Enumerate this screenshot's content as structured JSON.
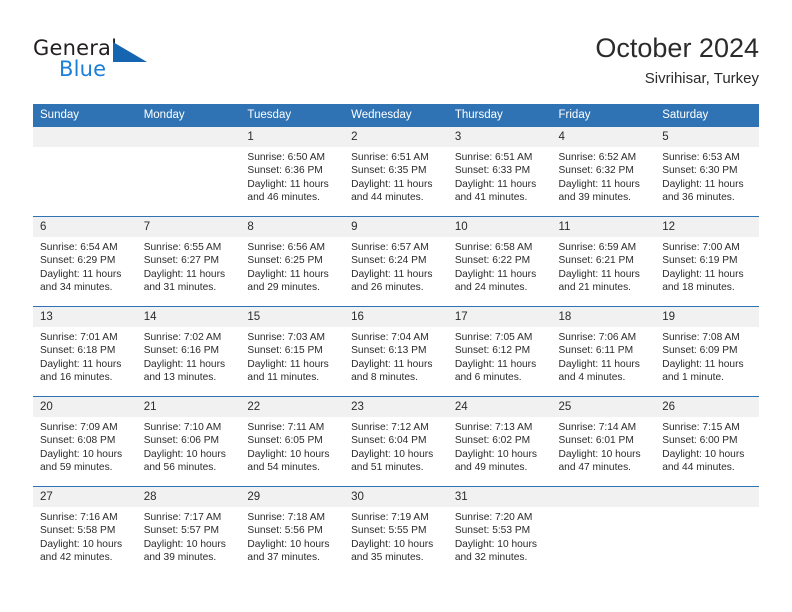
{
  "brand": {
    "word_one": "General",
    "word_two": "Blue",
    "logo_icon": "triangle-flag-icon",
    "accent_color": "#1565b0"
  },
  "header": {
    "title": "October 2024",
    "subtitle": "Sivrihisar, Turkey"
  },
  "theme": {
    "header_blue": "#3073b4",
    "daynum_bg": "#f1f1f1",
    "text": "#2b2b2b"
  },
  "weekday_headers": [
    "Sunday",
    "Monday",
    "Tuesday",
    "Wednesday",
    "Thursday",
    "Friday",
    "Saturday"
  ],
  "weeks": [
    [
      {
        "day": "",
        "empty": true
      },
      {
        "day": "",
        "empty": true
      },
      {
        "day": "1",
        "sunrise": "Sunrise: 6:50 AM",
        "sunset": "Sunset: 6:36 PM",
        "daylight_line1": "Daylight: 11 hours",
        "daylight_line2": "and 46 minutes."
      },
      {
        "day": "2",
        "sunrise": "Sunrise: 6:51 AM",
        "sunset": "Sunset: 6:35 PM",
        "daylight_line1": "Daylight: 11 hours",
        "daylight_line2": "and 44 minutes."
      },
      {
        "day": "3",
        "sunrise": "Sunrise: 6:51 AM",
        "sunset": "Sunset: 6:33 PM",
        "daylight_line1": "Daylight: 11 hours",
        "daylight_line2": "and 41 minutes."
      },
      {
        "day": "4",
        "sunrise": "Sunrise: 6:52 AM",
        "sunset": "Sunset: 6:32 PM",
        "daylight_line1": "Daylight: 11 hours",
        "daylight_line2": "and 39 minutes."
      },
      {
        "day": "5",
        "sunrise": "Sunrise: 6:53 AM",
        "sunset": "Sunset: 6:30 PM",
        "daylight_line1": "Daylight: 11 hours",
        "daylight_line2": "and 36 minutes."
      }
    ],
    [
      {
        "day": "6",
        "sunrise": "Sunrise: 6:54 AM",
        "sunset": "Sunset: 6:29 PM",
        "daylight_line1": "Daylight: 11 hours",
        "daylight_line2": "and 34 minutes."
      },
      {
        "day": "7",
        "sunrise": "Sunrise: 6:55 AM",
        "sunset": "Sunset: 6:27 PM",
        "daylight_line1": "Daylight: 11 hours",
        "daylight_line2": "and 31 minutes."
      },
      {
        "day": "8",
        "sunrise": "Sunrise: 6:56 AM",
        "sunset": "Sunset: 6:25 PM",
        "daylight_line1": "Daylight: 11 hours",
        "daylight_line2": "and 29 minutes."
      },
      {
        "day": "9",
        "sunrise": "Sunrise: 6:57 AM",
        "sunset": "Sunset: 6:24 PM",
        "daylight_line1": "Daylight: 11 hours",
        "daylight_line2": "and 26 minutes."
      },
      {
        "day": "10",
        "sunrise": "Sunrise: 6:58 AM",
        "sunset": "Sunset: 6:22 PM",
        "daylight_line1": "Daylight: 11 hours",
        "daylight_line2": "and 24 minutes."
      },
      {
        "day": "11",
        "sunrise": "Sunrise: 6:59 AM",
        "sunset": "Sunset: 6:21 PM",
        "daylight_line1": "Daylight: 11 hours",
        "daylight_line2": "and 21 minutes."
      },
      {
        "day": "12",
        "sunrise": "Sunrise: 7:00 AM",
        "sunset": "Sunset: 6:19 PM",
        "daylight_line1": "Daylight: 11 hours",
        "daylight_line2": "and 18 minutes."
      }
    ],
    [
      {
        "day": "13",
        "sunrise": "Sunrise: 7:01 AM",
        "sunset": "Sunset: 6:18 PM",
        "daylight_line1": "Daylight: 11 hours",
        "daylight_line2": "and 16 minutes."
      },
      {
        "day": "14",
        "sunrise": "Sunrise: 7:02 AM",
        "sunset": "Sunset: 6:16 PM",
        "daylight_line1": "Daylight: 11 hours",
        "daylight_line2": "and 13 minutes."
      },
      {
        "day": "15",
        "sunrise": "Sunrise: 7:03 AM",
        "sunset": "Sunset: 6:15 PM",
        "daylight_line1": "Daylight: 11 hours",
        "daylight_line2": "and 11 minutes."
      },
      {
        "day": "16",
        "sunrise": "Sunrise: 7:04 AM",
        "sunset": "Sunset: 6:13 PM",
        "daylight_line1": "Daylight: 11 hours",
        "daylight_line2": "and 8 minutes."
      },
      {
        "day": "17",
        "sunrise": "Sunrise: 7:05 AM",
        "sunset": "Sunset: 6:12 PM",
        "daylight_line1": "Daylight: 11 hours",
        "daylight_line2": "and 6 minutes."
      },
      {
        "day": "18",
        "sunrise": "Sunrise: 7:06 AM",
        "sunset": "Sunset: 6:11 PM",
        "daylight_line1": "Daylight: 11 hours",
        "daylight_line2": "and 4 minutes."
      },
      {
        "day": "19",
        "sunrise": "Sunrise: 7:08 AM",
        "sunset": "Sunset: 6:09 PM",
        "daylight_line1": "Daylight: 11 hours",
        "daylight_line2": "and 1 minute."
      }
    ],
    [
      {
        "day": "20",
        "sunrise": "Sunrise: 7:09 AM",
        "sunset": "Sunset: 6:08 PM",
        "daylight_line1": "Daylight: 10 hours",
        "daylight_line2": "and 59 minutes."
      },
      {
        "day": "21",
        "sunrise": "Sunrise: 7:10 AM",
        "sunset": "Sunset: 6:06 PM",
        "daylight_line1": "Daylight: 10 hours",
        "daylight_line2": "and 56 minutes."
      },
      {
        "day": "22",
        "sunrise": "Sunrise: 7:11 AM",
        "sunset": "Sunset: 6:05 PM",
        "daylight_line1": "Daylight: 10 hours",
        "daylight_line2": "and 54 minutes."
      },
      {
        "day": "23",
        "sunrise": "Sunrise: 7:12 AM",
        "sunset": "Sunset: 6:04 PM",
        "daylight_line1": "Daylight: 10 hours",
        "daylight_line2": "and 51 minutes."
      },
      {
        "day": "24",
        "sunrise": "Sunrise: 7:13 AM",
        "sunset": "Sunset: 6:02 PM",
        "daylight_line1": "Daylight: 10 hours",
        "daylight_line2": "and 49 minutes."
      },
      {
        "day": "25",
        "sunrise": "Sunrise: 7:14 AM",
        "sunset": "Sunset: 6:01 PM",
        "daylight_line1": "Daylight: 10 hours",
        "daylight_line2": "and 47 minutes."
      },
      {
        "day": "26",
        "sunrise": "Sunrise: 7:15 AM",
        "sunset": "Sunset: 6:00 PM",
        "daylight_line1": "Daylight: 10 hours",
        "daylight_line2": "and 44 minutes."
      }
    ],
    [
      {
        "day": "27",
        "sunrise": "Sunrise: 7:16 AM",
        "sunset": "Sunset: 5:58 PM",
        "daylight_line1": "Daylight: 10 hours",
        "daylight_line2": "and 42 minutes."
      },
      {
        "day": "28",
        "sunrise": "Sunrise: 7:17 AM",
        "sunset": "Sunset: 5:57 PM",
        "daylight_line1": "Daylight: 10 hours",
        "daylight_line2": "and 39 minutes."
      },
      {
        "day": "29",
        "sunrise": "Sunrise: 7:18 AM",
        "sunset": "Sunset: 5:56 PM",
        "daylight_line1": "Daylight: 10 hours",
        "daylight_line2": "and 37 minutes."
      },
      {
        "day": "30",
        "sunrise": "Sunrise: 7:19 AM",
        "sunset": "Sunset: 5:55 PM",
        "daylight_line1": "Daylight: 10 hours",
        "daylight_line2": "and 35 minutes."
      },
      {
        "day": "31",
        "sunrise": "Sunrise: 7:20 AM",
        "sunset": "Sunset: 5:53 PM",
        "daylight_line1": "Daylight: 10 hours",
        "daylight_line2": "and 32 minutes."
      },
      {
        "day": "",
        "empty": true
      },
      {
        "day": "",
        "empty": true
      }
    ]
  ]
}
